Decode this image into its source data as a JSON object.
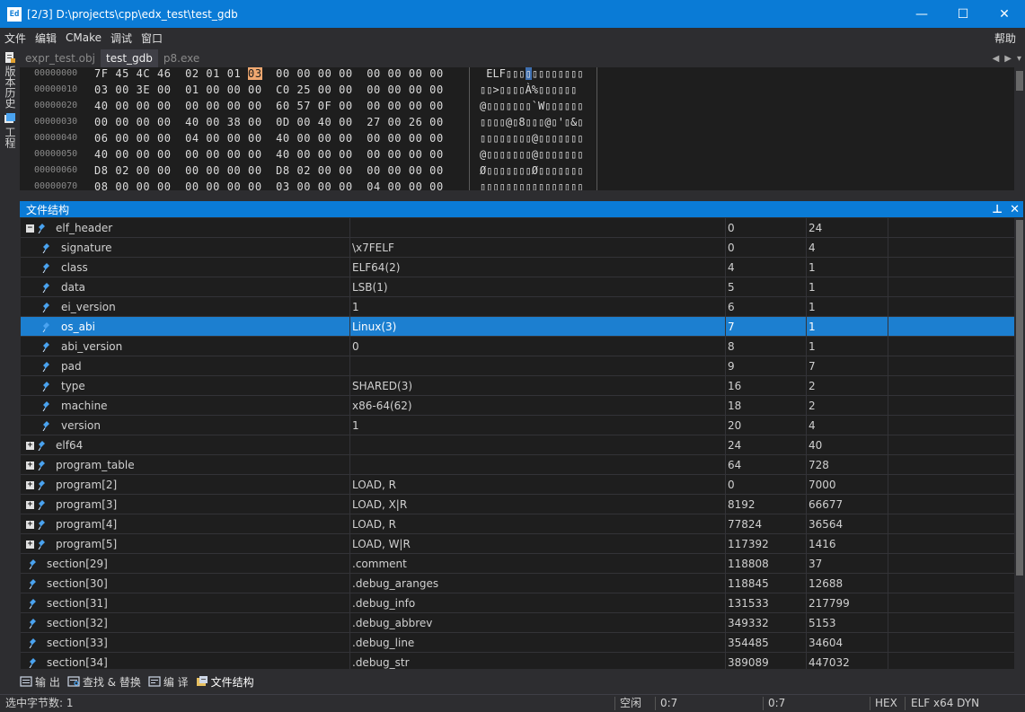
{
  "window": {
    "app_icon": "Ed",
    "title": "[2/3] D:\\projects\\cpp\\edx_test\\test_gdb",
    "minimize_glyph": "—",
    "maximize_glyph": "☐",
    "close_glyph": "✕"
  },
  "menu": {
    "items": [
      "文件",
      "编辑",
      "CMake",
      "调试",
      "窗口"
    ],
    "help": "帮助"
  },
  "side_strip": {
    "history_label": "版本历史",
    "project_label": "工程"
  },
  "doc_tabs": {
    "tabs": [
      "expr_test.obj",
      "test_gdb",
      "p8.exe"
    ],
    "active_index": 1,
    "nav_left": "◀",
    "nav_right": "▶",
    "nav_menu": "▾"
  },
  "hexview": {
    "rows": [
      {
        "addr": "00000000",
        "bytes_before": "7F 45 4C 46  02 01 01 ",
        "cursor": "03",
        "bytes_after": "  00 00 00 00  00 00 00 00",
        "ascii_before": " ELF▯▯▯",
        "ascii_cursor": "▯",
        "ascii_after": "▯▯▯▯▯▯▯▯"
      },
      {
        "addr": "00000010",
        "bytes_before": "03 00 3E 00  01 00 00 00  C0 25 00 00  00 00 00 00",
        "cursor": "",
        "bytes_after": "",
        "ascii_before": "▯▯>▯▯▯▯À%▯▯▯▯▯▯",
        "ascii_cursor": "",
        "ascii_after": ""
      },
      {
        "addr": "00000020",
        "bytes_before": "40 00 00 00  00 00 00 00  60 57 0F 00  00 00 00 00",
        "cursor": "",
        "bytes_after": "",
        "ascii_before": "@▯▯▯▯▯▯▯`W▯▯▯▯▯▯",
        "ascii_cursor": "",
        "ascii_after": ""
      },
      {
        "addr": "00000030",
        "bytes_before": "00 00 00 00  40 00 38 00  0D 00 40 00  27 00 26 00",
        "cursor": "",
        "bytes_after": "",
        "ascii_before": "▯▯▯▯@▯8▯▯▯@▯'▯&▯",
        "ascii_cursor": "",
        "ascii_after": ""
      },
      {
        "addr": "00000040",
        "bytes_before": "06 00 00 00  04 00 00 00  40 00 00 00  00 00 00 00",
        "cursor": "",
        "bytes_after": "",
        "ascii_before": "▯▯▯▯▯▯▯▯@▯▯▯▯▯▯▯",
        "ascii_cursor": "",
        "ascii_after": ""
      },
      {
        "addr": "00000050",
        "bytes_before": "40 00 00 00  00 00 00 00  40 00 00 00  00 00 00 00",
        "cursor": "",
        "bytes_after": "",
        "ascii_before": "@▯▯▯▯▯▯▯@▯▯▯▯▯▯▯",
        "ascii_cursor": "",
        "ascii_after": ""
      },
      {
        "addr": "00000060",
        "bytes_before": "D8 02 00 00  00 00 00 00  D8 02 00 00  00 00 00 00",
        "cursor": "",
        "bytes_after": "",
        "ascii_before": "Ø▯▯▯▯▯▯▯Ø▯▯▯▯▯▯▯",
        "ascii_cursor": "",
        "ascii_after": ""
      },
      {
        "addr": "00000070",
        "bytes_before": "08 00 00 00  00 00 00 00  03 00 00 00  04 00 00 00",
        "cursor": "",
        "bytes_after": "",
        "ascii_before": "▯▯▯▯▯▯▯▯▯▯▯▯▯▯▯▯",
        "ascii_cursor": "",
        "ascii_after": ""
      }
    ]
  },
  "struct_panel": {
    "title": "文件结构",
    "pin_glyph": "⊥",
    "close_glyph": "✕",
    "rows": [
      {
        "depth": 0,
        "expander": "−",
        "name": "elf_header",
        "value": "",
        "offset": "0",
        "size": "24",
        "selected": false
      },
      {
        "depth": 1,
        "expander": "",
        "name": "signature",
        "value": "\\x7FELF",
        "offset": "0",
        "size": "4",
        "selected": false
      },
      {
        "depth": 1,
        "expander": "",
        "name": "class",
        "value": "ELF64(2)",
        "offset": "4",
        "size": "1",
        "selected": false
      },
      {
        "depth": 1,
        "expander": "",
        "name": "data",
        "value": "LSB(1)",
        "offset": "5",
        "size": "1",
        "selected": false
      },
      {
        "depth": 1,
        "expander": "",
        "name": "ei_version",
        "value": "1",
        "offset": "6",
        "size": "1",
        "selected": false
      },
      {
        "depth": 1,
        "expander": "",
        "name": "os_abi",
        "value": "Linux(3)",
        "offset": "7",
        "size": "1",
        "selected": true
      },
      {
        "depth": 1,
        "expander": "",
        "name": "abi_version",
        "value": "0",
        "offset": "8",
        "size": "1",
        "selected": false
      },
      {
        "depth": 1,
        "expander": "",
        "name": "pad",
        "value": "",
        "offset": "9",
        "size": "7",
        "selected": false
      },
      {
        "depth": 1,
        "expander": "",
        "name": "type",
        "value": "SHARED(3)",
        "offset": "16",
        "size": "2",
        "selected": false
      },
      {
        "depth": 1,
        "expander": "",
        "name": "machine",
        "value": "x86-64(62)",
        "offset": "18",
        "size": "2",
        "selected": false
      },
      {
        "depth": 1,
        "expander": "",
        "name": "version",
        "value": "1",
        "offset": "20",
        "size": "4",
        "selected": false
      },
      {
        "depth": 0,
        "expander": "+",
        "name": "elf64",
        "value": "",
        "offset": "24",
        "size": "40",
        "selected": false
      },
      {
        "depth": 0,
        "expander": "+",
        "name": "program_table",
        "value": "",
        "offset": "64",
        "size": "728",
        "selected": false
      },
      {
        "depth": 0,
        "expander": "+",
        "name": "program[2]",
        "value": "LOAD, R",
        "offset": "0",
        "size": "7000",
        "selected": false
      },
      {
        "depth": 0,
        "expander": "+",
        "name": "program[3]",
        "value": "LOAD, X|R",
        "offset": "8192",
        "size": "66677",
        "selected": false
      },
      {
        "depth": 0,
        "expander": "+",
        "name": "program[4]",
        "value": "LOAD, R",
        "offset": "77824",
        "size": "36564",
        "selected": false
      },
      {
        "depth": 0,
        "expander": "+",
        "name": "program[5]",
        "value": "LOAD, W|R",
        "offset": "117392",
        "size": "1416",
        "selected": false
      },
      {
        "depth": -1,
        "expander": "",
        "name": "section[29]",
        "value": ".comment",
        "offset": "118808",
        "size": "37",
        "selected": false
      },
      {
        "depth": -1,
        "expander": "",
        "name": "section[30]",
        "value": ".debug_aranges",
        "offset": "118845",
        "size": "12688",
        "selected": false
      },
      {
        "depth": -1,
        "expander": "",
        "name": "section[31]",
        "value": ".debug_info",
        "offset": "131533",
        "size": "217799",
        "selected": false
      },
      {
        "depth": -1,
        "expander": "",
        "name": "section[32]",
        "value": ".debug_abbrev",
        "offset": "349332",
        "size": "5153",
        "selected": false
      },
      {
        "depth": -1,
        "expander": "",
        "name": "section[33]",
        "value": ".debug_line",
        "offset": "354485",
        "size": "34604",
        "selected": false
      },
      {
        "depth": -1,
        "expander": "",
        "name": "section[34]",
        "value": ".debug_str",
        "offset": "389089",
        "size": "447032",
        "selected": false
      }
    ]
  },
  "bottom_tabs": {
    "output": "输 出",
    "find_replace": "查找 & 替换",
    "compile": "编 译",
    "file_struct": "文件结构"
  },
  "status": {
    "selected_bytes": "选中字节数: 1",
    "state": "空闲",
    "pos1": "0:7",
    "pos2": "0:7",
    "mode": "HEX",
    "format": "ELF x64 DYN"
  },
  "colors": {
    "accent": "#0a7bd6",
    "selection": "#1c7fd0",
    "hex_cursor": "#f0a870",
    "ascii_cursor": "#3e6fb0",
    "pin_icon": "#4aa3f0"
  }
}
